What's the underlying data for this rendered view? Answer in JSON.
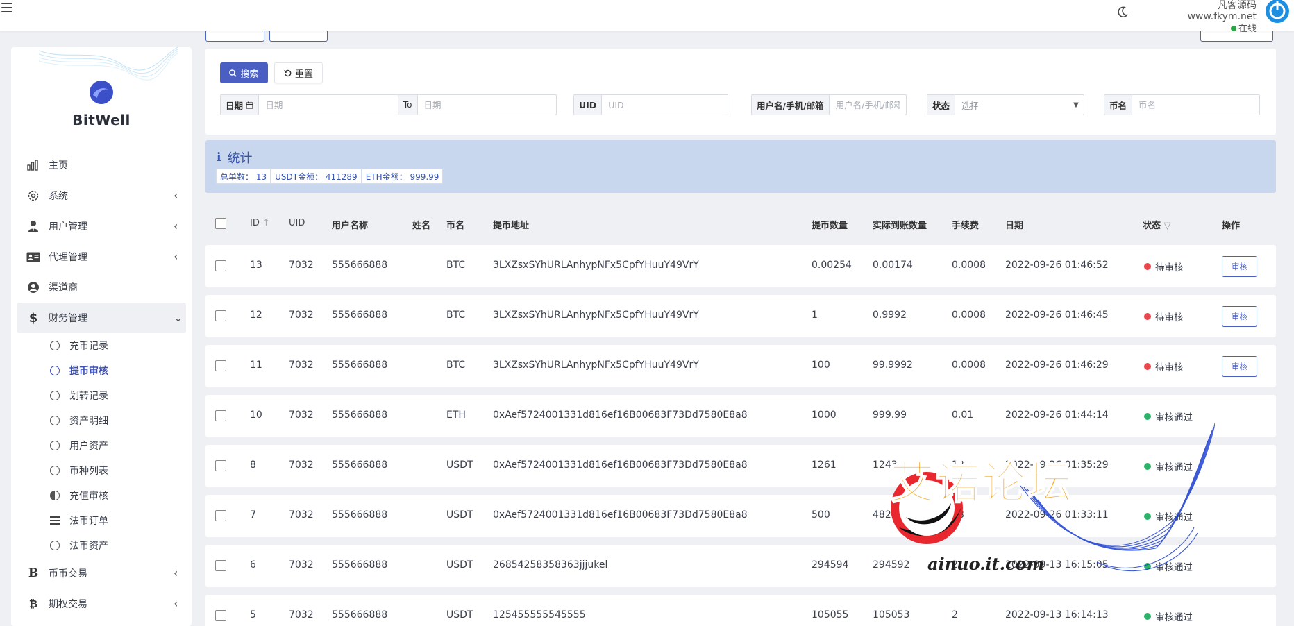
{
  "topbar": {
    "site_name": "凡客源码www.fkym.net",
    "status": "在线",
    "status_color": "#28a745"
  },
  "sidebar": {
    "logo_text": "BitWell",
    "items": [
      {
        "label": "主页",
        "icon": "chart-icon"
      },
      {
        "label": "系统",
        "icon": "gear-icon"
      },
      {
        "label": "用户管理",
        "icon": "user-tie-icon"
      },
      {
        "label": "代理管理",
        "icon": "id-card-icon"
      },
      {
        "label": "渠道商",
        "icon": "user-circle-icon"
      },
      {
        "label": "财务管理",
        "icon": "dollar-icon"
      }
    ],
    "sub_items": [
      "充币记录",
      "提币审核",
      "划转记录",
      "资产明细",
      "用户资产",
      "币种列表",
      "充值审核",
      "法币订单",
      "法币资产"
    ],
    "bottom_items": [
      {
        "label": "币币交易",
        "icon": "bold-b-icon"
      },
      {
        "label": "期权交易",
        "icon": "bitcoin-icon"
      }
    ]
  },
  "search": {
    "search_label": "搜索",
    "reset_label": "重置",
    "date_label": "日期",
    "date_placeholder": "日期",
    "to_label": "To",
    "date_to_placeholder": "日期",
    "uid_label": "UID",
    "uid_placeholder": "UID",
    "user_label": "用户名/手机/邮箱",
    "user_placeholder": "用户名/手机/邮箱",
    "status_label": "状态",
    "status_placeholder": "选择",
    "coin_label": "币名",
    "coin_placeholder": "币名"
  },
  "stats": {
    "title": "统计",
    "total_orders": "总单数： 13",
    "usdt_amount": "USDT金额： 411289",
    "eth_amount": "ETH金额： 999.99"
  },
  "table": {
    "headers": {
      "id": "ID",
      "uid": "UID",
      "username": "用户名称",
      "name": "姓名",
      "coin": "币名",
      "address": "提币地址",
      "amount": "提币数量",
      "actual": "实际到账数量",
      "fee": "手续费",
      "date": "日期",
      "status": "状态",
      "action": "操作"
    },
    "audit_label": "审核",
    "rows": [
      {
        "id": "13",
        "uid": "7032",
        "username": "555666888",
        "coin": "BTC",
        "address": "3LXZsxSYhURLAnhypNFx5CpfYHuuY49VrY",
        "amount": "0.00254",
        "actual": "0.00174",
        "fee": "0.0008",
        "date": "2022-09-26 01:46:52",
        "status": "待审核"
      },
      {
        "id": "12",
        "uid": "7032",
        "username": "555666888",
        "coin": "BTC",
        "address": "3LXZsxSYhURLAnhypNFx5CpfYHuuY49VrY",
        "amount": "1",
        "actual": "0.9992",
        "fee": "0.0008",
        "date": "2022-09-26 01:46:45",
        "status": "待审核"
      },
      {
        "id": "11",
        "uid": "7032",
        "username": "555666888",
        "coin": "BTC",
        "address": "3LXZsxSYhURLAnhypNFx5CpfYHuuY49VrY",
        "amount": "100",
        "actual": "99.9992",
        "fee": "0.0008",
        "date": "2022-09-26 01:46:29",
        "status": "待审核"
      },
      {
        "id": "10",
        "uid": "7032",
        "username": "555666888",
        "coin": "ETH",
        "address": "0xAef5724001331d816ef16B00683F73Dd7580E8a8",
        "amount": "1000",
        "actual": "999.99",
        "fee": "0.01",
        "date": "2022-09-26 01:44:14",
        "status": "审核通过"
      },
      {
        "id": "8",
        "uid": "7032",
        "username": "555666888",
        "coin": "USDT",
        "address": "0xAef5724001331d816ef16B00683F73Dd7580E8a8",
        "amount": "1261",
        "actual": "1243",
        "fee": "18",
        "date": "2022-09-26 01:35:29",
        "status": "审核通过"
      },
      {
        "id": "7",
        "uid": "7032",
        "username": "555666888",
        "coin": "USDT",
        "address": "0xAef5724001331d816ef16B00683F73Dd7580E8a8",
        "amount": "500",
        "actual": "482",
        "fee": "18",
        "date": "2022-09-26 01:33:11",
        "status": "审核通过"
      },
      {
        "id": "6",
        "uid": "7032",
        "username": "555666888",
        "coin": "USDT",
        "address": "26854258358363jjjukel",
        "amount": "294594",
        "actual": "294592",
        "fee": "2",
        "date": "2022-09-13 16:15:05",
        "status": "审核通过"
      },
      {
        "id": "5",
        "uid": "7032",
        "username": "555666888",
        "coin": "USDT",
        "address": "125455555545555",
        "amount": "105055",
        "actual": "105053",
        "fee": "2",
        "date": "2022-09-13 16:14:13",
        "status": "审核通过"
      }
    ]
  },
  "colors": {
    "pending": "#e5484d",
    "approved": "#2fb36a",
    "accent": "#4a5fc1"
  },
  "watermark": {
    "text": "艾诺论坛",
    "url": "ainuo.it.com"
  }
}
